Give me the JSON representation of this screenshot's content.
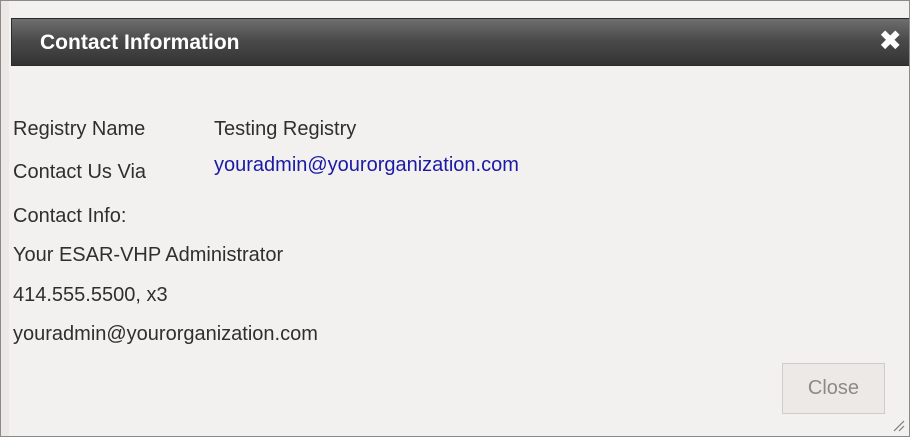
{
  "dialog": {
    "title": "Contact Information",
    "close_icon_glyph": "✖"
  },
  "details": {
    "registry_name_label": "Registry Name",
    "registry_name_value": "Testing Registry",
    "contact_via_label": "Contact Us Via",
    "contact_via_value": "youradmin@yourorganization.com",
    "contact_info_label": "Contact Info:",
    "contact_info_lines": [
      "Your ESAR-VHP Administrator",
      "414.555.5500, x3",
      "youradmin@yourorganization.com"
    ]
  },
  "footer": {
    "close_label": "Close"
  },
  "icons": {
    "close": "close-icon",
    "resize": "resize-grip-icon"
  },
  "colors": {
    "title_bar": "#4b4b4b",
    "dialog_bg": "#f3f1ef",
    "link": "#1a1aa6",
    "text": "#2f2f2f"
  }
}
